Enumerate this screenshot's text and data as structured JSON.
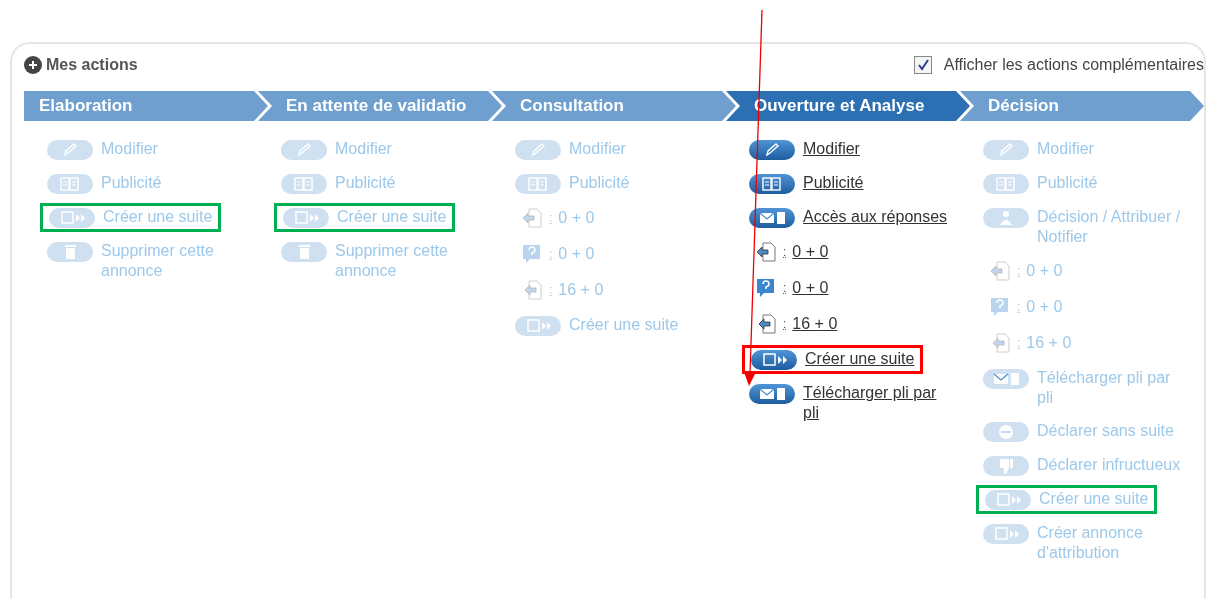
{
  "panel": {
    "title": "Mes actions",
    "show_extra": {
      "label": "Afficher les actions complémentaires",
      "checked": true
    }
  },
  "phases": [
    {
      "label": "Elaboration",
      "selected": false,
      "items": [
        {
          "kind": "modify",
          "label": "Modifier",
          "disabled": true
        },
        {
          "kind": "publicity",
          "label": "Publicité",
          "disabled": true
        },
        {
          "kind": "next",
          "label": "Créer une suite",
          "disabled": true,
          "color": "#00b050"
        },
        {
          "kind": "delete",
          "label": "Supprimer cette annonce",
          "disabled": true
        }
      ]
    },
    {
      "label": "En attente de validatio",
      "selected": false,
      "items": [
        {
          "kind": "modify",
          "label": "Modifier",
          "disabled": true
        },
        {
          "kind": "publicity",
          "label": "Publicité",
          "disabled": true
        },
        {
          "kind": "next",
          "label": "Créer une suite",
          "disabled": true,
          "color": "#00b050"
        },
        {
          "kind": "delete",
          "label": "Supprimer cette annonce",
          "disabled": true
        }
      ]
    },
    {
      "label": "Consultation",
      "selected": false,
      "items": [
        {
          "kind": "modify",
          "label": "Modifier",
          "disabled": true
        },
        {
          "kind": "publicity",
          "label": "Publicité",
          "disabled": true
        },
        {
          "kind": "count-out",
          "separator": ":",
          "label": "0 + 0",
          "disabled": true
        },
        {
          "kind": "count-question",
          "separator": ":",
          "label": "0 + 0",
          "disabled": true
        },
        {
          "kind": "count-in",
          "separator": ":",
          "label": "16 + 0",
          "disabled": true
        },
        {
          "kind": "next",
          "label": "Créer une suite",
          "disabled": true
        }
      ]
    },
    {
      "label": "Ouverture et Analyse",
      "selected": true,
      "items": [
        {
          "kind": "modify",
          "label": "Modifier",
          "disabled": false
        },
        {
          "kind": "publicity",
          "label": "Publicité",
          "disabled": false
        },
        {
          "kind": "responses",
          "label": "Accès aux réponses",
          "disabled": false
        },
        {
          "kind": "count-out",
          "separator": ":",
          "label": "0 + 0",
          "disabled": false
        },
        {
          "kind": "count-question",
          "separator": ":",
          "label": "0 + 0",
          "disabled": false
        },
        {
          "kind": "count-in",
          "separator": ":",
          "label": "16 + 0",
          "disabled": false
        },
        {
          "kind": "next",
          "label": "Créer une suite",
          "disabled": false,
          "color": "#ff0000"
        },
        {
          "kind": "download",
          "label": "Télécharger pli par pli",
          "disabled": false
        }
      ]
    },
    {
      "label": "Décision",
      "selected": false,
      "items": [
        {
          "kind": "modify",
          "label": "Modifier",
          "disabled": true
        },
        {
          "kind": "publicity",
          "label": "Publicité",
          "disabled": true
        },
        {
          "kind": "decision",
          "label": "Décision / Attribuer / Notifier",
          "disabled": true
        },
        {
          "kind": "count-out",
          "separator": ":",
          "label": "0 + 0",
          "disabled": true
        },
        {
          "kind": "count-question",
          "separator": ":",
          "label": "0 + 0",
          "disabled": true
        },
        {
          "kind": "count-in",
          "separator": ":",
          "label": "16 + 0",
          "disabled": true
        },
        {
          "kind": "download",
          "label": "Télécharger pli par pli",
          "disabled": true
        },
        {
          "kind": "cancel",
          "label": "Déclarer sans suite",
          "disabled": true
        },
        {
          "kind": "unsuccessful",
          "label": "Déclarer infructueux",
          "disabled": true
        },
        {
          "kind": "next",
          "label": "Créer une suite",
          "disabled": true,
          "color": "#00b050"
        },
        {
          "kind": "next",
          "label": "Créer annonce d'attribution",
          "disabled": true
        }
      ]
    }
  ]
}
